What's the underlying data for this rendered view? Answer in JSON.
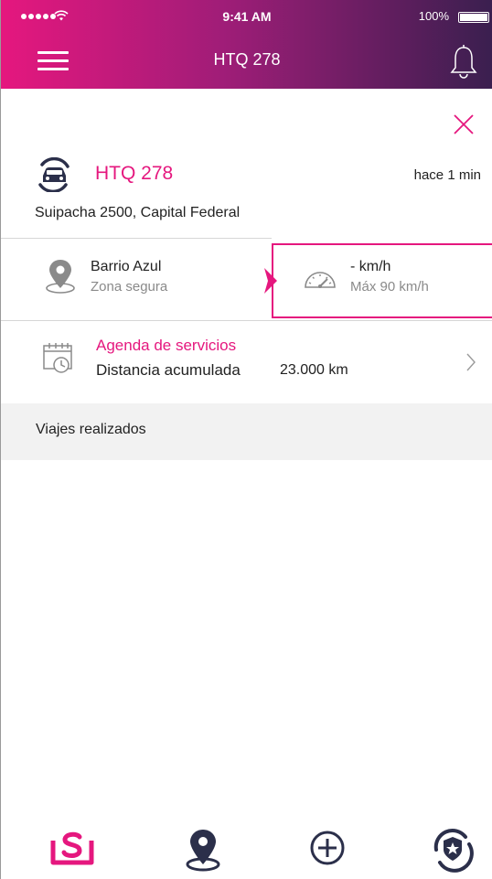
{
  "status_bar": {
    "time": "9:41 AM",
    "battery": "100%"
  },
  "header": {
    "title": "HTQ 278"
  },
  "vehicle": {
    "plate": "HTQ 278",
    "last_update": "hace 1 min",
    "address": "Suipacha 2500, Capital Federal"
  },
  "zone": {
    "name": "Barrio Azul",
    "status": "Zona segura"
  },
  "speed": {
    "current": "- km/h",
    "max": "Máx 90 km/h"
  },
  "services": {
    "title": "Agenda de servicios",
    "distance_label": "Distancia acumulada",
    "distance_value": "23.000 km"
  },
  "trips": {
    "label": "Viajes realizados"
  },
  "colors": {
    "accent": "#e5177e",
    "dark": "#2b2f4a",
    "header_end": "#3a1f4f"
  },
  "bottom_nav": {
    "items": [
      {
        "icon": "service-s-icon",
        "active": true
      },
      {
        "icon": "location-pin-icon",
        "active": false
      },
      {
        "icon": "plus-circle-icon",
        "active": false
      },
      {
        "icon": "shield-star-icon",
        "active": false
      }
    ]
  }
}
